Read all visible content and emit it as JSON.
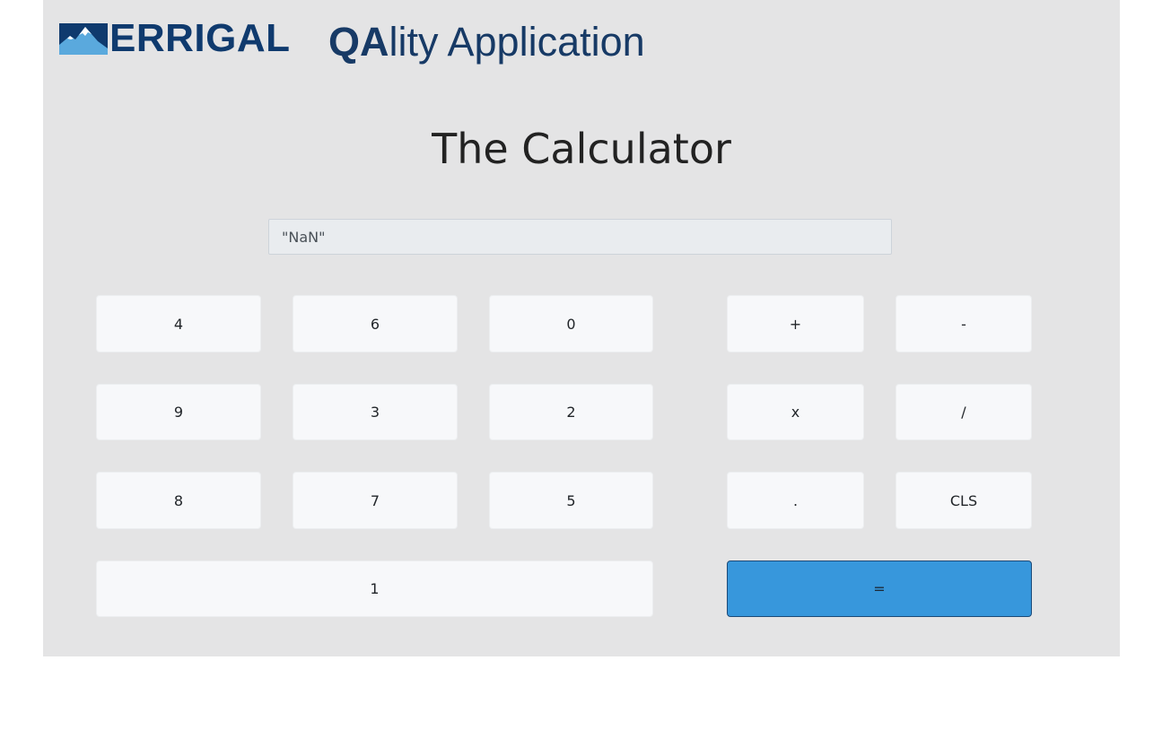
{
  "header": {
    "logo_text": "ERRIGAL",
    "app_title_bold": "QA",
    "app_title_rest": "lity Application"
  },
  "calculator": {
    "title": "The Calculator",
    "display_value": "\"NaN\"",
    "digit_buttons": {
      "r1c1": "4",
      "r1c2": "6",
      "r1c3": "0",
      "r2c1": "9",
      "r2c2": "3",
      "r2c3": "2",
      "r3c1": "8",
      "r3c2": "7",
      "r3c3": "5",
      "wide": "1"
    },
    "operator_buttons": {
      "add": "+",
      "subtract": "-",
      "multiply": "x",
      "divide": "/",
      "decimal": ".",
      "clear": "CLS",
      "equals": "="
    }
  },
  "colors": {
    "page_bg": "#e4e4e5",
    "brand_navy": "#0f3a6e",
    "button_bg": "#f7f8fa",
    "equals_bg": "#3797dc",
    "display_bg": "#e9ecef"
  },
  "icons": {
    "logo_mark": "mountain-icon"
  }
}
